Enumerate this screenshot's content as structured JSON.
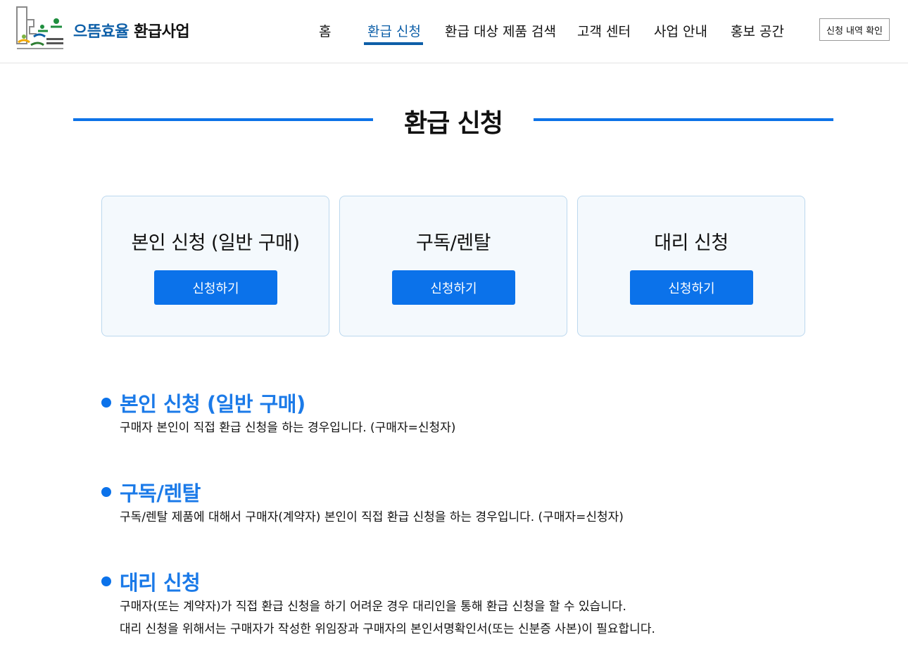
{
  "brand": {
    "part1": "으뜸효율",
    "part2": "환급사업"
  },
  "nav": {
    "items": [
      {
        "label": "홈"
      },
      {
        "label": "환급 신청"
      },
      {
        "label": "환급 대상 제품 검색"
      },
      {
        "label": "고객 센터"
      },
      {
        "label": "사업 안내"
      },
      {
        "label": "홍보 공간"
      }
    ],
    "history_button": "신청 내역 확인"
  },
  "page_title": "환급 신청",
  "cards": [
    {
      "title": "본인 신청 (일반 구매)",
      "button": "신청하기"
    },
    {
      "title": "구독/렌탈",
      "button": "신청하기"
    },
    {
      "title": "대리 신청",
      "button": "신청하기"
    }
  ],
  "sections": [
    {
      "title": "본인 신청 (일반 구매)",
      "lines": [
        "구매자 본인이 직접 환급 신청을 하는 경우입니다. (구매자=신청자)"
      ]
    },
    {
      "title": "구독/렌탈",
      "lines": [
        "구독/렌탈 제품에 대해서 구매자(계약자) 본인이 직접 환급 신청을 하는 경우입니다. (구매자=신청자)"
      ]
    },
    {
      "title": "대리 신청",
      "lines": [
        "구매자(또는 계약자)가 직접 환급 신청을 하기 어려운 경우 대리인을 통해 환급 신청을 할 수 있습니다.",
        "대리 신청을 위해서는 구매자가 작성한 위임장과 구매자의 본인서명확인서(또는 신분증 사본)이 필요합니다."
      ]
    }
  ],
  "colors": {
    "primary": "#0b72ea",
    "brand_blue": "#0d5fa8",
    "card_bg": "#f4f9fd",
    "card_border": "#bcd8ee"
  }
}
